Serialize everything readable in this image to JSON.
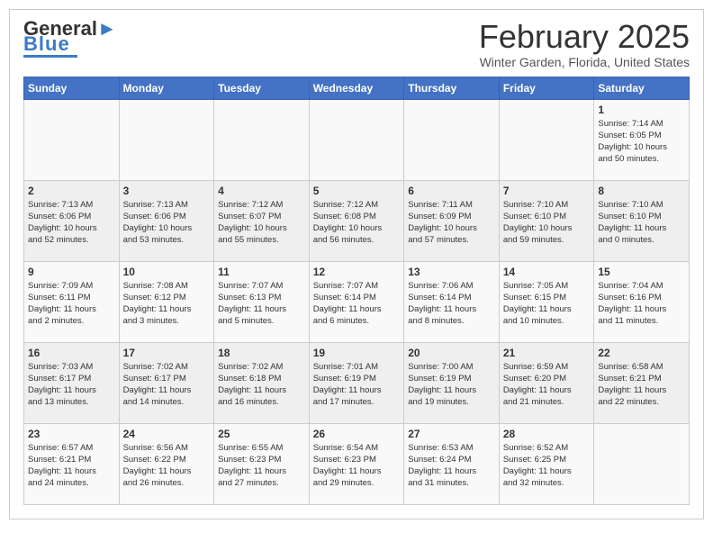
{
  "header": {
    "logo_general": "General",
    "logo_blue": "Blue",
    "month_title": "February 2025",
    "location": "Winter Garden, Florida, United States"
  },
  "calendar": {
    "days_of_week": [
      "Sunday",
      "Monday",
      "Tuesday",
      "Wednesday",
      "Thursday",
      "Friday",
      "Saturday"
    ],
    "weeks": [
      [
        {
          "day": "",
          "info": ""
        },
        {
          "day": "",
          "info": ""
        },
        {
          "day": "",
          "info": ""
        },
        {
          "day": "",
          "info": ""
        },
        {
          "day": "",
          "info": ""
        },
        {
          "day": "",
          "info": ""
        },
        {
          "day": "1",
          "info": "Sunrise: 7:14 AM\nSunset: 6:05 PM\nDaylight: 10 hours\nand 50 minutes."
        }
      ],
      [
        {
          "day": "2",
          "info": "Sunrise: 7:13 AM\nSunset: 6:06 PM\nDaylight: 10 hours\nand 52 minutes."
        },
        {
          "day": "3",
          "info": "Sunrise: 7:13 AM\nSunset: 6:06 PM\nDaylight: 10 hours\nand 53 minutes."
        },
        {
          "day": "4",
          "info": "Sunrise: 7:12 AM\nSunset: 6:07 PM\nDaylight: 10 hours\nand 55 minutes."
        },
        {
          "day": "5",
          "info": "Sunrise: 7:12 AM\nSunset: 6:08 PM\nDaylight: 10 hours\nand 56 minutes."
        },
        {
          "day": "6",
          "info": "Sunrise: 7:11 AM\nSunset: 6:09 PM\nDaylight: 10 hours\nand 57 minutes."
        },
        {
          "day": "7",
          "info": "Sunrise: 7:10 AM\nSunset: 6:10 PM\nDaylight: 10 hours\nand 59 minutes."
        },
        {
          "day": "8",
          "info": "Sunrise: 7:10 AM\nSunset: 6:10 PM\nDaylight: 11 hours\nand 0 minutes."
        }
      ],
      [
        {
          "day": "9",
          "info": "Sunrise: 7:09 AM\nSunset: 6:11 PM\nDaylight: 11 hours\nand 2 minutes."
        },
        {
          "day": "10",
          "info": "Sunrise: 7:08 AM\nSunset: 6:12 PM\nDaylight: 11 hours\nand 3 minutes."
        },
        {
          "day": "11",
          "info": "Sunrise: 7:07 AM\nSunset: 6:13 PM\nDaylight: 11 hours\nand 5 minutes."
        },
        {
          "day": "12",
          "info": "Sunrise: 7:07 AM\nSunset: 6:14 PM\nDaylight: 11 hours\nand 6 minutes."
        },
        {
          "day": "13",
          "info": "Sunrise: 7:06 AM\nSunset: 6:14 PM\nDaylight: 11 hours\nand 8 minutes."
        },
        {
          "day": "14",
          "info": "Sunrise: 7:05 AM\nSunset: 6:15 PM\nDaylight: 11 hours\nand 10 minutes."
        },
        {
          "day": "15",
          "info": "Sunrise: 7:04 AM\nSunset: 6:16 PM\nDaylight: 11 hours\nand 11 minutes."
        }
      ],
      [
        {
          "day": "16",
          "info": "Sunrise: 7:03 AM\nSunset: 6:17 PM\nDaylight: 11 hours\nand 13 minutes."
        },
        {
          "day": "17",
          "info": "Sunrise: 7:02 AM\nSunset: 6:17 PM\nDaylight: 11 hours\nand 14 minutes."
        },
        {
          "day": "18",
          "info": "Sunrise: 7:02 AM\nSunset: 6:18 PM\nDaylight: 11 hours\nand 16 minutes."
        },
        {
          "day": "19",
          "info": "Sunrise: 7:01 AM\nSunset: 6:19 PM\nDaylight: 11 hours\nand 17 minutes."
        },
        {
          "day": "20",
          "info": "Sunrise: 7:00 AM\nSunset: 6:19 PM\nDaylight: 11 hours\nand 19 minutes."
        },
        {
          "day": "21",
          "info": "Sunrise: 6:59 AM\nSunset: 6:20 PM\nDaylight: 11 hours\nand 21 minutes."
        },
        {
          "day": "22",
          "info": "Sunrise: 6:58 AM\nSunset: 6:21 PM\nDaylight: 11 hours\nand 22 minutes."
        }
      ],
      [
        {
          "day": "23",
          "info": "Sunrise: 6:57 AM\nSunset: 6:21 PM\nDaylight: 11 hours\nand 24 minutes."
        },
        {
          "day": "24",
          "info": "Sunrise: 6:56 AM\nSunset: 6:22 PM\nDaylight: 11 hours\nand 26 minutes."
        },
        {
          "day": "25",
          "info": "Sunrise: 6:55 AM\nSunset: 6:23 PM\nDaylight: 11 hours\nand 27 minutes."
        },
        {
          "day": "26",
          "info": "Sunrise: 6:54 AM\nSunset: 6:23 PM\nDaylight: 11 hours\nand 29 minutes."
        },
        {
          "day": "27",
          "info": "Sunrise: 6:53 AM\nSunset: 6:24 PM\nDaylight: 11 hours\nand 31 minutes."
        },
        {
          "day": "28",
          "info": "Sunrise: 6:52 AM\nSunset: 6:25 PM\nDaylight: 11 hours\nand 32 minutes."
        },
        {
          "day": "",
          "info": ""
        }
      ]
    ]
  }
}
